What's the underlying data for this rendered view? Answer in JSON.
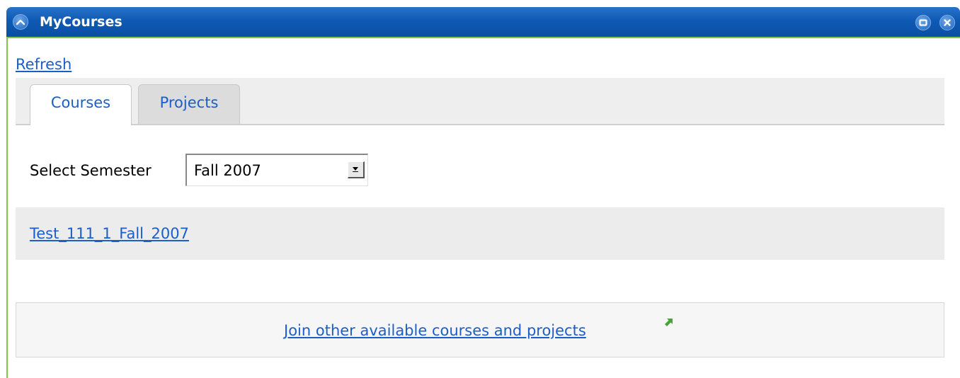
{
  "portlet": {
    "title": "MyCourses",
    "icons": {
      "collapse": "chevron-up-icon",
      "maximize": "maximize-icon",
      "close": "close-icon"
    },
    "colors": {
      "titlebar": "#0f5ab4",
      "accent_border": "#7cc94a",
      "link": "#1a5fc9"
    }
  },
  "refresh_label": "Refresh",
  "tabs": [
    {
      "label": "Courses",
      "active": true
    },
    {
      "label": "Projects",
      "active": false
    }
  ],
  "semester": {
    "label": "Select Semester",
    "selected": "Fall 2007"
  },
  "courses": [
    {
      "name": "Test_111_1_Fall_2007"
    }
  ],
  "join": {
    "label": "Join other available courses and projects",
    "icon": "external-link-icon"
  }
}
